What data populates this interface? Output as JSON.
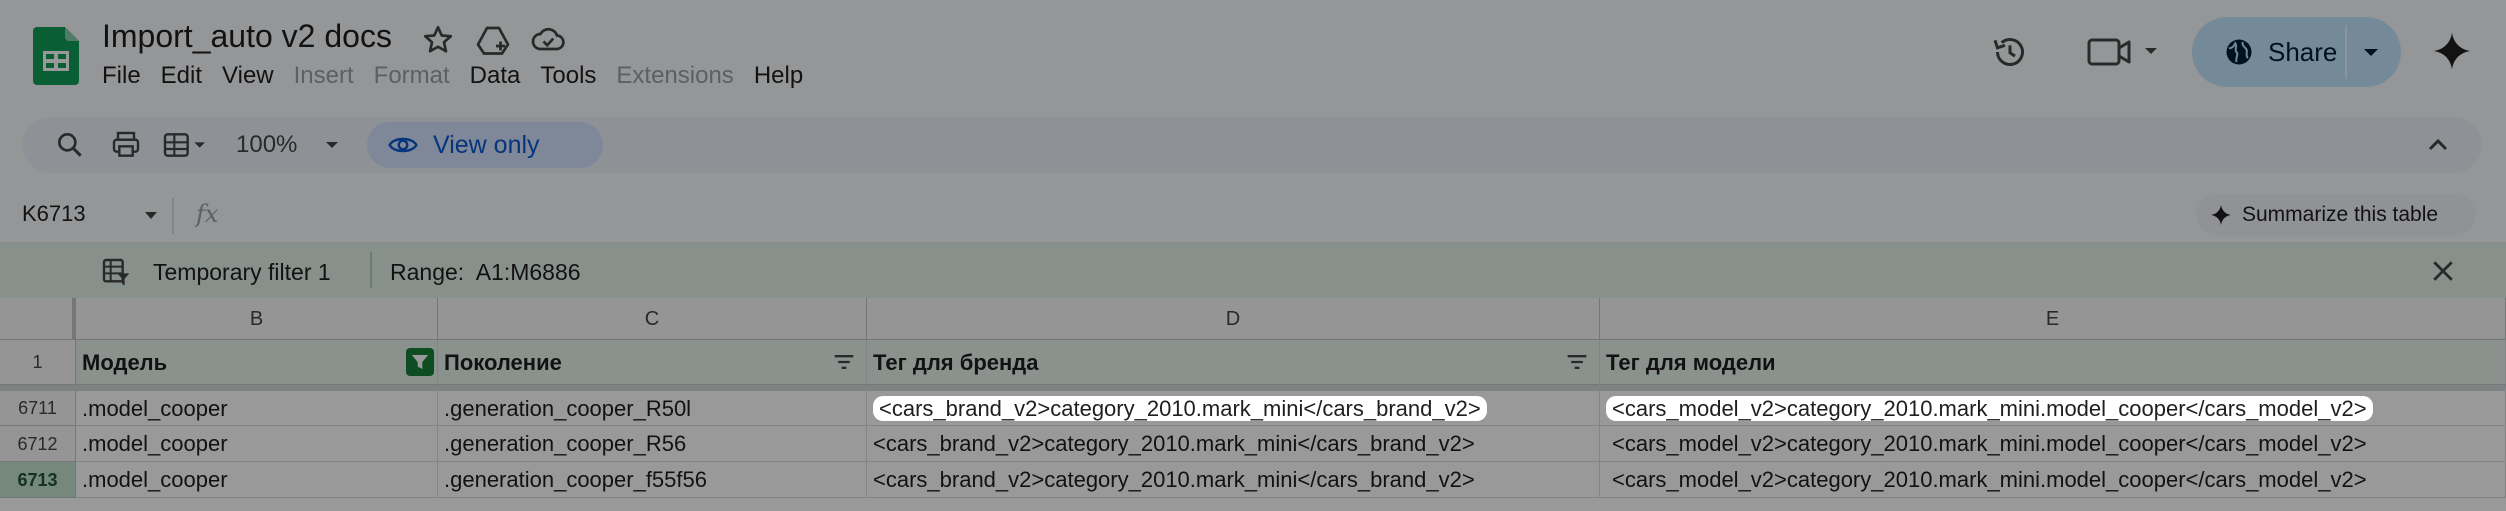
{
  "app": {
    "doc_title": "Import_auto v2 docs",
    "menu": [
      {
        "label": "File",
        "enabled": true
      },
      {
        "label": "Edit",
        "enabled": true
      },
      {
        "label": "View",
        "enabled": true
      },
      {
        "label": "Insert",
        "enabled": false
      },
      {
        "label": "Format",
        "enabled": false
      },
      {
        "label": "Data",
        "enabled": true
      },
      {
        "label": "Tools",
        "enabled": true
      },
      {
        "label": "Extensions",
        "enabled": false
      },
      {
        "label": "Help",
        "enabled": true
      }
    ],
    "share_label": "Share"
  },
  "toolbar": {
    "zoom": "100%",
    "view_only_label": "View only"
  },
  "formula_bar": {
    "name_box": "K6713",
    "fx": "fx",
    "summarize_label": "Summarize this table"
  },
  "filter_bar": {
    "name": "Temporary filter 1",
    "range_label": "Range:",
    "range_value": "A1:M6886"
  },
  "grid": {
    "columns": [
      "B",
      "C",
      "D",
      "E"
    ],
    "header_row_number": "1",
    "headers": [
      "Модель",
      "Поколение",
      "Тег для бренда",
      "Тег для модели"
    ],
    "rows": [
      {
        "num": "6711",
        "cells": [
          ".model_cooper",
          ".generation_cooper_R50l",
          "<cars_brand_v2>category_2010.mark_mini</cars_brand_v2>",
          "<cars_model_v2>category_2010.mark_mini.model_cooper</cars_model_v2>"
        ]
      },
      {
        "num": "6712",
        "cells": [
          ".model_cooper",
          ".generation_cooper_R56",
          "<cars_brand_v2>category_2010.mark_mini</cars_brand_v2>",
          "<cars_model_v2>category_2010.mark_mini.model_cooper</cars_model_v2>"
        ]
      },
      {
        "num": "6713",
        "cells": [
          ".model_cooper",
          ".generation_cooper_f55f56",
          "<cars_brand_v2>category_2010.mark_mini</cars_brand_v2>",
          "<cars_model_v2>category_2010.mark_mini.model_cooper</cars_model_v2>"
        ]
      }
    ]
  },
  "colors": {
    "accent": "#0b57d0",
    "share_bg": "#c2e7ff",
    "sheets_green": "#0f9d58",
    "filter_bar": "#e3f1e8"
  }
}
